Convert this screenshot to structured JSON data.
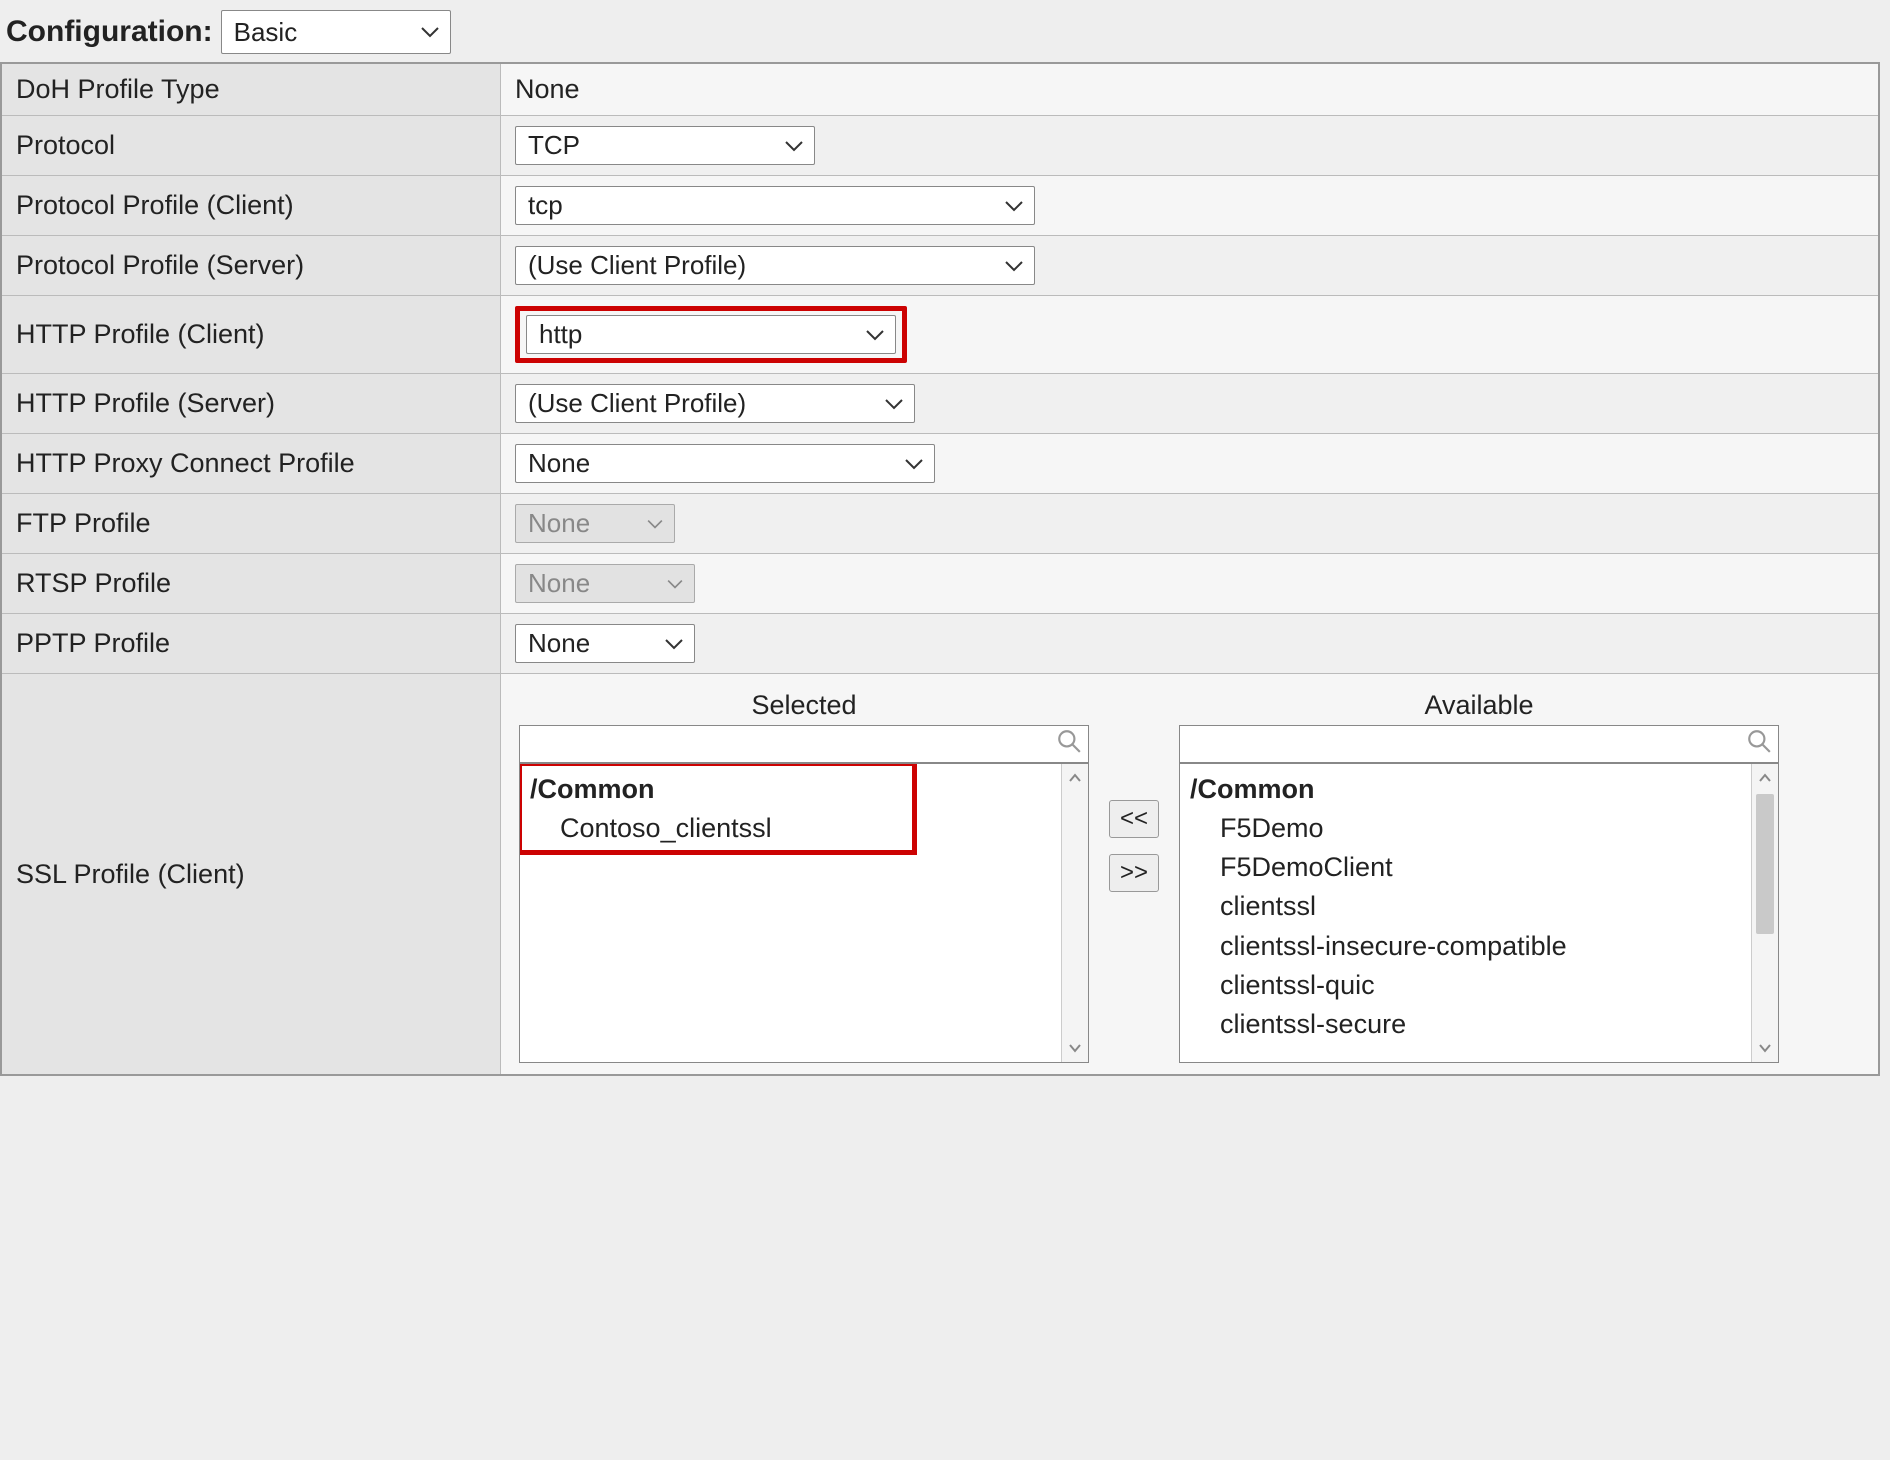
{
  "top": {
    "label": "Configuration:",
    "value": "Basic"
  },
  "rows": {
    "doh": {
      "label": "DoH Profile Type",
      "value": "None"
    },
    "protocol": {
      "label": "Protocol",
      "value": "TCP"
    },
    "pp_client": {
      "label": "Protocol Profile (Client)",
      "value": "tcp"
    },
    "pp_server": {
      "label": "Protocol Profile (Server)",
      "value": "(Use Client Profile)"
    },
    "http_client": {
      "label": "HTTP Profile (Client)",
      "value": "http"
    },
    "http_server": {
      "label": "HTTP Profile (Server)",
      "value": "(Use Client Profile)"
    },
    "http_proxy": {
      "label": "HTTP Proxy Connect Profile",
      "value": "None"
    },
    "ftp": {
      "label": "FTP Profile",
      "value": "None"
    },
    "rtsp": {
      "label": "RTSP Profile",
      "value": "None"
    },
    "pptp": {
      "label": "PPTP Profile",
      "value": "None"
    },
    "ssl_client": {
      "label": "SSL Profile (Client)"
    }
  },
  "dual": {
    "selected_title": "Selected",
    "available_title": "Available",
    "group_label": "/Common",
    "selected_items": [
      "Contoso_clientssl"
    ],
    "available_items": [
      "F5Demo",
      "F5DemoClient",
      "clientssl",
      "clientssl-insecure-compatible",
      "clientssl-quic",
      "clientssl-secure"
    ],
    "move_left": "<<",
    "move_right": ">>"
  }
}
